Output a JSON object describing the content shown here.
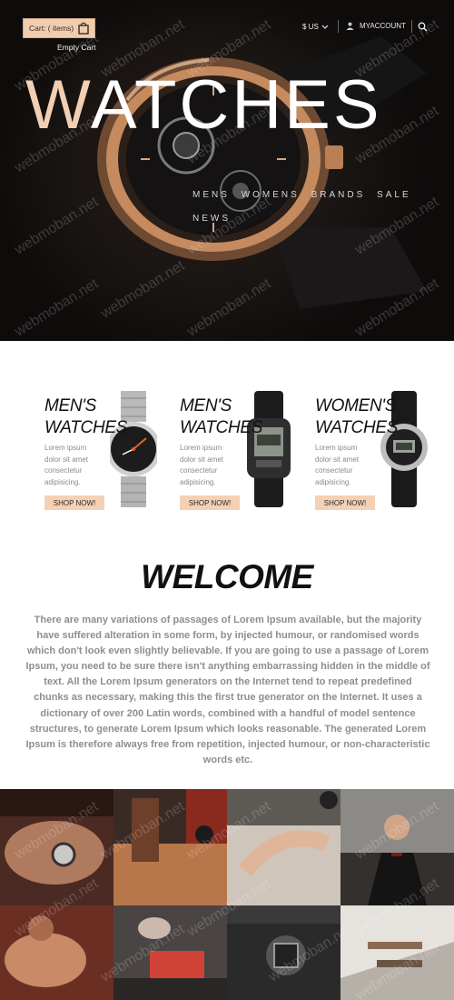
{
  "header": {
    "cart_label": "Cart: ( items)",
    "empty_cart": "Empty Cart",
    "currency": "$ US",
    "account": "MYACCOUNT"
  },
  "hero": {
    "title_first": "W",
    "title_rest": "ATCHES",
    "nav": [
      "MENS",
      "WOMENS",
      "BRANDS",
      "SALE",
      "NEWS"
    ]
  },
  "products": [
    {
      "line1": "MEN'S",
      "line2": "WATCHES",
      "desc": "Lorem ipsum dolor sit amet consectetur adipisicing.",
      "button": "SHOP NOW!"
    },
    {
      "line1": "MEN'S",
      "line2": "WATCHES",
      "desc": "Lorem ipsum dolor sit amet consectetur adipisicing.",
      "button": "SHOP NOW!"
    },
    {
      "line1": "WOMEN'S",
      "line2": "WATCHES",
      "desc": "Lorem ipsum dolor sit amet consectetur adipisicing.",
      "button": "SHOP NOW!"
    }
  ],
  "welcome": {
    "title": "WELCOME",
    "body": "There are many variations of passages of Lorem Ipsum available, but the majority have suffered alteration in some form, by injected humour, or randomised words which don't look even slightly believable. If you are going to use a passage of Lorem Ipsum, you need to be sure there isn't anything embarrassing hidden in the middle of text. All the Lorem Ipsum generators on the Internet tend to repeat predefined chunks as necessary, making this the first true generator on the Internet. It uses a dictionary of over 200 Latin words, combined with a handful of model sentence structures, to generate Lorem Ipsum which looks reasonable. The generated Lorem Ipsum is therefore always free from repetition, injected humour, or non-characteristic words etc."
  },
  "watermark": "webmoban.net",
  "colors": {
    "accent": "#f1cdb0",
    "dark": "#111111",
    "body_text": "#8e8e8e"
  }
}
